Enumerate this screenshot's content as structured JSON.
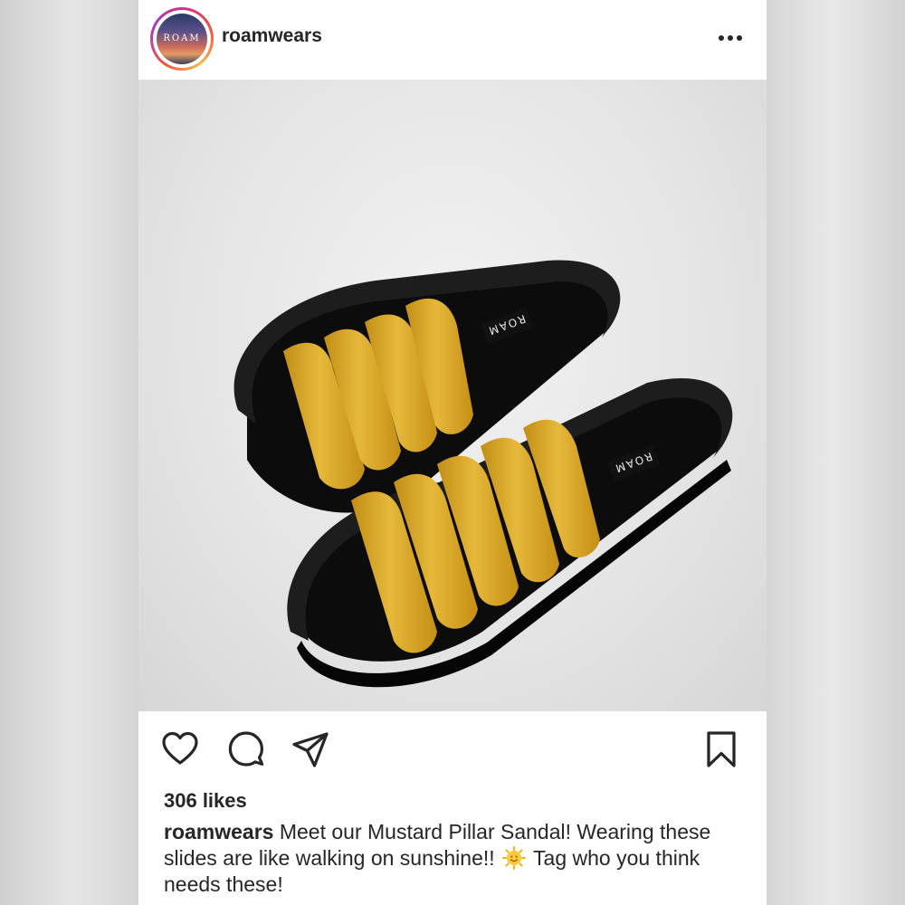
{
  "post": {
    "username": "roamwears",
    "avatar_text": "ROAM",
    "more_icon": "more-horizontal-icon",
    "photo_label_1": "ROAM",
    "photo_label_2": "ROAM",
    "likes_text": "306 likes",
    "caption_user": "roamwears",
    "caption_part1": "Meet our Mustard Pillar Sandal! Wearing these slides are like walking on sunshine!!",
    "caption_emoji": "sun-with-face-emoji",
    "caption_part2": "Tag who you think needs these!",
    "icons": {
      "like": "heart-icon",
      "comment": "comment-icon",
      "share": "send-icon",
      "save": "bookmark-icon"
    },
    "colors": {
      "text": "#262626",
      "sandal_strap": "#d8a620",
      "sandal_sole": "#111111",
      "background": "#ffffff"
    }
  }
}
